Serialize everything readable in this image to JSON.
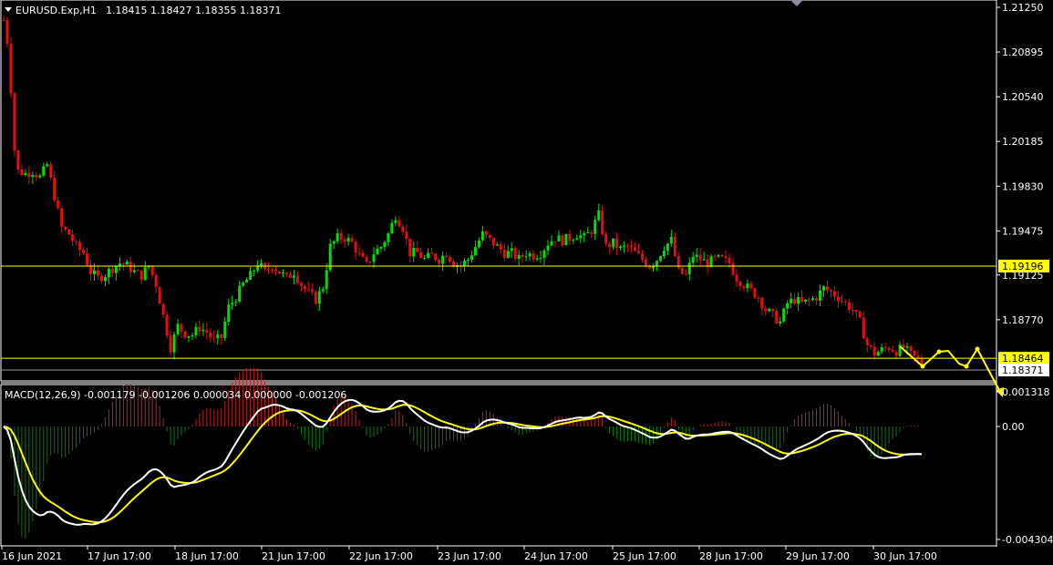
{
  "header": {
    "symbol_label": "EURUSD.Exp,H1",
    "ohlc": "1.18415 1.18427 1.18355 1.18371"
  },
  "colors": {
    "background": "#000000",
    "bull": "#00e000",
    "bear": "#e01010",
    "grid_border": "#ffffff",
    "level_line": "#ffff00",
    "macd_line": "#ffffff",
    "signal_line": "#ffff00",
    "hist_pos": "#c02020",
    "hist_neg": "#008000",
    "arrow": "#ffff00"
  },
  "price_axis": {
    "ticks": [
      "1.21250",
      "1.20895",
      "1.20540",
      "1.20185",
      "1.19830",
      "1.19475",
      "1.19125",
      "1.18770"
    ],
    "ylim": [
      1.1835,
      1.2125
    ]
  },
  "levels": [
    {
      "label": "1.19196",
      "value": 1.19196,
      "style": "line"
    },
    {
      "label": "1.18464",
      "value": 1.18464,
      "style": "line"
    },
    {
      "label": "1.18371",
      "value": 1.18371,
      "style": "current"
    }
  ],
  "macd_panel": {
    "label": "MACD(12,26,9) -0.001179 -0.001206 0.000034 0.000000 -0.001206",
    "ticks": [
      "0.001318",
      "0.00",
      "-0.004304"
    ]
  },
  "time_axis": {
    "labels": [
      "16 Jun 2021",
      "17 Jun 17:00",
      "18 Jun 17:00",
      "21 Jun 17:00",
      "22 Jun 17:00",
      "23 Jun 17:00",
      "24 Jun 17:00",
      "25 Jun 17:00",
      "28 Jun 17:00",
      "29 Jun 17:00",
      "30 Jun 17:00"
    ]
  },
  "chart_data": {
    "type": "candlestick",
    "symbol": "EURUSD.Exp",
    "timeframe": "H1",
    "price_keypoints": [
      [
        0,
        1.2115
      ],
      [
        1,
        1.2098
      ],
      [
        2,
        1.206
      ],
      [
        3,
        1.2012
      ],
      [
        4,
        1.1995
      ],
      [
        6,
        1.1993
      ],
      [
        8,
        1.1995
      ],
      [
        10,
        1.199
      ],
      [
        12,
        1.2
      ],
      [
        14,
        1.1975
      ],
      [
        16,
        1.195
      ],
      [
        18,
        1.1945
      ],
      [
        20,
        1.1935
      ],
      [
        22,
        1.193
      ],
      [
        24,
        1.1915
      ],
      [
        26,
        1.191
      ],
      [
        28,
        1.1913
      ],
      [
        30,
        1.1918
      ],
      [
        32,
        1.1922
      ],
      [
        34,
        1.192
      ],
      [
        36,
        1.1915
      ],
      [
        38,
        1.1912
      ],
      [
        40,
        1.192
      ],
      [
        42,
        1.1905
      ],
      [
        44,
        1.188
      ],
      [
        46,
        1.1855
      ],
      [
        48,
        1.1872
      ],
      [
        50,
        1.1866
      ],
      [
        52,
        1.1865
      ],
      [
        54,
        1.1871
      ],
      [
        56,
        1.1867
      ],
      [
        58,
        1.186
      ],
      [
        60,
        1.1863
      ],
      [
        62,
        1.1887
      ],
      [
        64,
        1.1895
      ],
      [
        66,
        1.1905
      ],
      [
        68,
        1.1912
      ],
      [
        70,
        1.1922
      ],
      [
        72,
        1.1915
      ],
      [
        74,
        1.192
      ],
      [
        76,
        1.1915
      ],
      [
        78,
        1.191
      ],
      [
        80,
        1.1915
      ],
      [
        82,
        1.1905
      ],
      [
        84,
        1.1898
      ],
      [
        86,
        1.1893
      ],
      [
        88,
        1.1903
      ],
      [
        90,
        1.1935
      ],
      [
        92,
        1.1942
      ],
      [
        94,
        1.1942
      ],
      [
        96,
        1.1938
      ],
      [
        98,
        1.1928
      ],
      [
        100,
        1.192
      ],
      [
        102,
        1.193
      ],
      [
        104,
        1.1935
      ],
      [
        106,
        1.1945
      ],
      [
        108,
        1.196
      ],
      [
        110,
        1.195
      ],
      [
        112,
        1.193
      ],
      [
        114,
        1.193
      ],
      [
        116,
        1.1925
      ],
      [
        118,
        1.1928
      ],
      [
        120,
        1.1925
      ],
      [
        122,
        1.193
      ],
      [
        124,
        1.1922
      ],
      [
        126,
        1.192
      ],
      [
        128,
        1.1925
      ],
      [
        130,
        1.1935
      ],
      [
        132,
        1.1945
      ],
      [
        134,
        1.194
      ],
      [
        136,
        1.1935
      ],
      [
        138,
        1.193
      ],
      [
        140,
        1.193
      ],
      [
        142,
        1.1925
      ],
      [
        144,
        1.193
      ],
      [
        146,
        1.1928
      ],
      [
        148,
        1.193
      ],
      [
        150,
        1.1938
      ],
      [
        152,
        1.1942
      ],
      [
        154,
        1.194
      ],
      [
        156,
        1.1942
      ],
      [
        158,
        1.1945
      ],
      [
        160,
        1.1942
      ],
      [
        162,
        1.1948
      ],
      [
        164,
        1.196
      ],
      [
        166,
        1.1935
      ],
      [
        168,
        1.1938
      ],
      [
        170,
        1.1933
      ],
      [
        172,
        1.1935
      ],
      [
        174,
        1.193
      ],
      [
        176,
        1.1925
      ],
      [
        178,
        1.192
      ],
      [
        180,
        1.1925
      ],
      [
        182,
        1.1935
      ],
      [
        184,
        1.194
      ],
      [
        186,
        1.1915
      ],
      [
        188,
        1.1912
      ],
      [
        190,
        1.1928
      ],
      [
        192,
        1.1925
      ],
      [
        194,
        1.1922
      ],
      [
        196,
        1.1925
      ],
      [
        198,
        1.1925
      ],
      [
        200,
        1.1922
      ],
      [
        202,
        1.191
      ],
      [
        204,
        1.1905
      ],
      [
        206,
        1.19
      ],
      [
        208,
        1.1895
      ],
      [
        210,
        1.1885
      ],
      [
        212,
        1.188
      ],
      [
        214,
        1.1875
      ],
      [
        216,
        1.189
      ],
      [
        218,
        1.1893
      ],
      [
        220,
        1.189
      ],
      [
        222,
        1.1892
      ],
      [
        224,
        1.1895
      ],
      [
        226,
        1.1902
      ],
      [
        228,
        1.1899
      ],
      [
        230,
        1.1895
      ],
      [
        232,
        1.189
      ],
      [
        234,
        1.1885
      ],
      [
        236,
        1.1875
      ],
      [
        238,
        1.1857
      ],
      [
        240,
        1.185
      ],
      [
        242,
        1.1853
      ],
      [
        244,
        1.1855
      ],
      [
        246,
        1.1852
      ],
      [
        248,
        1.1855
      ],
      [
        250,
        1.1849
      ],
      [
        252,
        1.1845
      ],
      [
        253,
        1.1842
      ]
    ],
    "candle_count": 254,
    "price_range": [
      1.1835,
      1.2125
    ],
    "macd_range": [
      -0.004304,
      0.001318
    ],
    "macd_last": {
      "main": -0.001179,
      "signal": -0.001206,
      "hist": 3.4e-05
    },
    "forecast_arrows": "zigzag projection after last candle"
  }
}
